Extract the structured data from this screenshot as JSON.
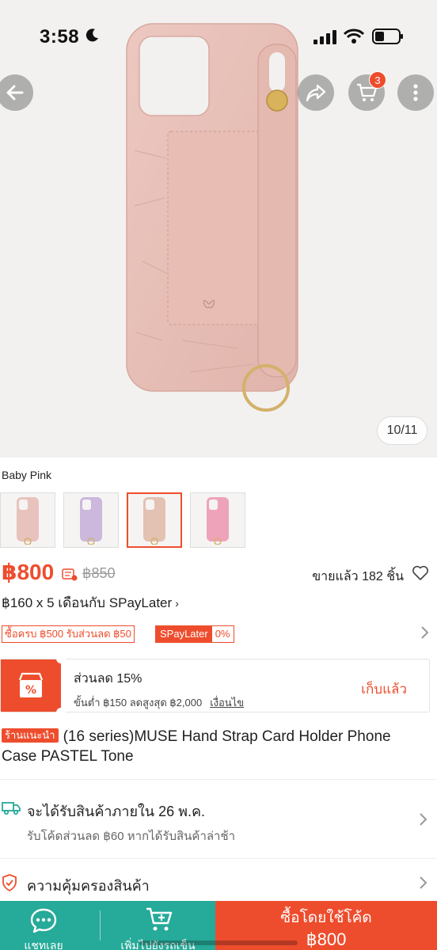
{
  "status_bar": {
    "time": "3:58"
  },
  "header": {
    "cart_count": "3"
  },
  "gallery": {
    "counter": "10/11"
  },
  "variant": {
    "selected_label": "Baby Pink",
    "options": [
      {
        "color": "#e8c3bd"
      },
      {
        "color": "#cbb8dc"
      },
      {
        "color": "#e3c1b3"
      },
      {
        "color": "#eea3bb"
      }
    ]
  },
  "price": {
    "current": "฿800",
    "original": "฿850",
    "sold": "ขายแล้ว 182 ชิ้น"
  },
  "installment": {
    "text": "฿160 x 5 เดือนกับ SPayLater"
  },
  "promos": {
    "tag1": "ซื้อครบ ฿500 รับส่วนลด ฿50",
    "tag2_brand": "SPayLater",
    "tag2_value": "0%"
  },
  "voucher": {
    "title": "ส่วนลด 15%",
    "subtitle": "ขั้นต่ำ ฿150 ลดสูงสุด ฿2,000",
    "condition": "เงื่อนไข",
    "action": "เก็บแล้ว"
  },
  "product": {
    "badge": "ร้านแนะนำ",
    "title": "(16 series)MUSE Hand Strap Card Holder Phone Case PASTEL Tone"
  },
  "delivery": {
    "title": "จะได้รับสินค้าภายใน 26 พ.ค.",
    "subtitle": "รับโค้ดส่วนลด ฿60 หากได้รับสินค้าล่าช้า"
  },
  "guarantee": {
    "title": "ความคุ้มครองสินค้า"
  },
  "bottom_bar": {
    "chat": "แชทเลย",
    "add_to_cart": "เพิ่มไปยังรถเข็น",
    "buy_label": "ซื้อโดยใช้โค้ด",
    "buy_price": "฿800"
  },
  "colors": {
    "accent": "#ee4d2d",
    "teal": "#26aa99",
    "case_pink": "#e8c2ba"
  }
}
